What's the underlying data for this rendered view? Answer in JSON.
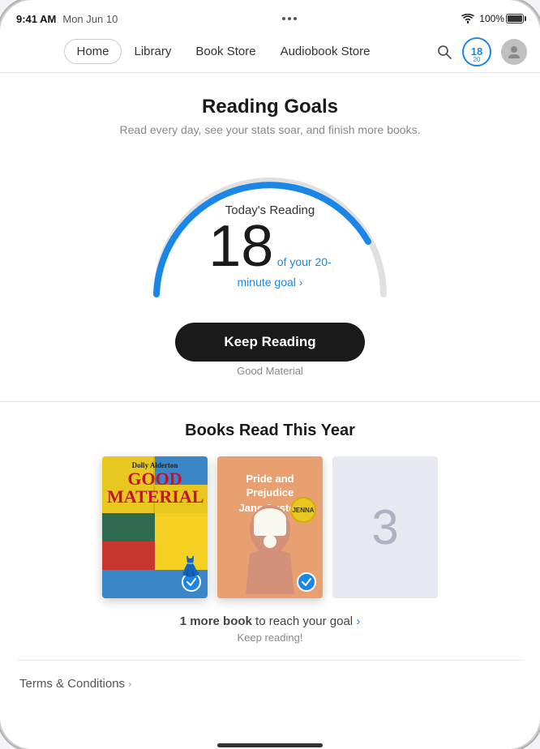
{
  "status_bar": {
    "time": "9:41 AM",
    "date": "Mon Jun 10",
    "wifi": "wifi",
    "battery_percent": "100%"
  },
  "nav": {
    "items": [
      {
        "label": "Home",
        "active": true
      },
      {
        "label": "Library",
        "active": false
      },
      {
        "label": "Book Store",
        "active": false
      },
      {
        "label": "Audiobook Store",
        "active": false
      }
    ],
    "search_label": "Search",
    "badge_number": "18",
    "badge_sub": "20"
  },
  "reading_goals": {
    "title": "Reading Goals",
    "subtitle": "Read every day, see your stats soar, and finish more books.",
    "today_label": "Today's Reading",
    "minutes": "18",
    "goal_text": "of your 20-minute goal",
    "chevron": "›",
    "keep_reading_label": "Keep Reading",
    "book_title": "Good Material"
  },
  "books_section": {
    "title": "Books Read This Year",
    "book1": {
      "author": "Dolly Alderton",
      "title": "GOOD\nMATERIAL"
    },
    "book2": {
      "title": "Pride and\nPrejudice",
      "author": "Jane Austen"
    },
    "book3": {
      "number": "3"
    },
    "goal_prefix": "1 more book",
    "goal_suffix": " to reach your goal",
    "goal_chevron": "›",
    "keep_reading": "Keep reading!"
  },
  "terms": {
    "label": "Terms & Conditions",
    "chevron": "›"
  }
}
